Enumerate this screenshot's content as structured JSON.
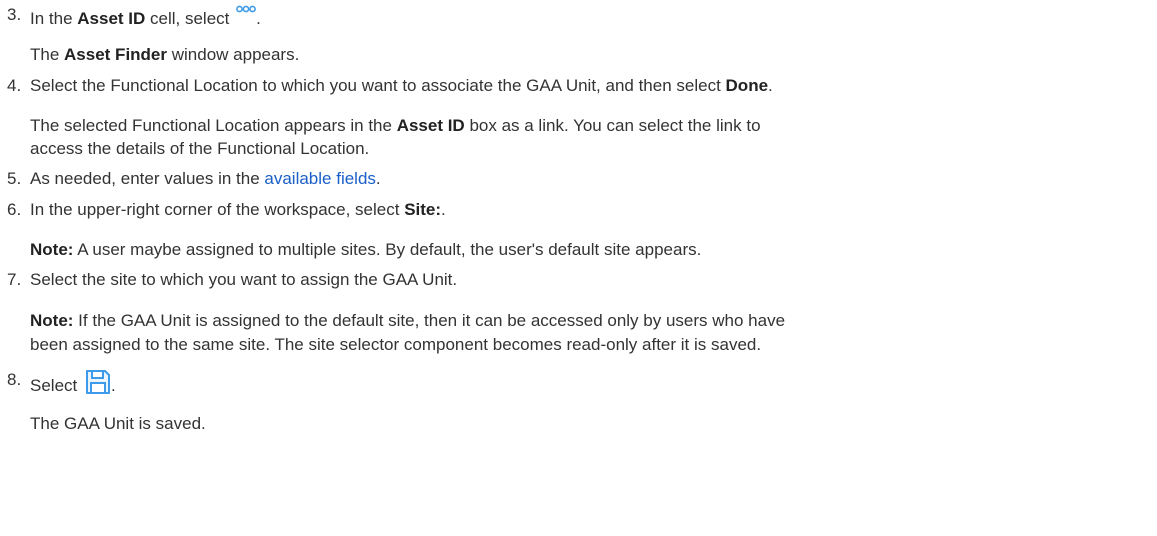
{
  "step3": {
    "number": "3.",
    "pre": "In the ",
    "bold": "Asset ID",
    "post": " cell, select ",
    "end": ".",
    "icon": "more-options-icon",
    "result_bold": "Asset Finder",
    "result_pre": "The ",
    "result_post": " window appears."
  },
  "step4": {
    "number": "4.",
    "pre": "Select the Functional Location to which you want to associate the GAA Unit, and then select ",
    "bold": "Done",
    "end": ".",
    "result_line1_pre": "The selected Functional Location appears in the ",
    "result_line1_bold": "Asset ID",
    "result_line1_post": " box as a link. You can select the link to",
    "result_line2": "access the details of the Functional Location."
  },
  "step5": {
    "number": "5.",
    "pre": "As needed, enter values in the ",
    "link": "available fields",
    "end": "."
  },
  "step6": {
    "number": "6.",
    "pre": "In the upper-right corner of the workspace, select ",
    "bold": "Site:",
    "end": ".",
    "note_label": "Note:",
    "note_text": " A user maybe assigned to multiple sites. By default, the user's default site appears."
  },
  "step7": {
    "number": "7.",
    "text": "Select the site to which you want to assign the GAA Unit.",
    "note_label": "Note:",
    "note_line1": " If the GAA Unit is assigned to the default site, then it can be accessed only by users who have",
    "note_line2": "been assigned to the same site. The site selector component becomes read-only after it is saved."
  },
  "step8": {
    "number": "8.",
    "pre": "Select ",
    "end": ".",
    "icon": "save-icon",
    "result": "The GAA Unit is saved."
  },
  "colors": {
    "text": "#333333",
    "link": "#1a5fc7",
    "icon": "#3d9be9"
  }
}
